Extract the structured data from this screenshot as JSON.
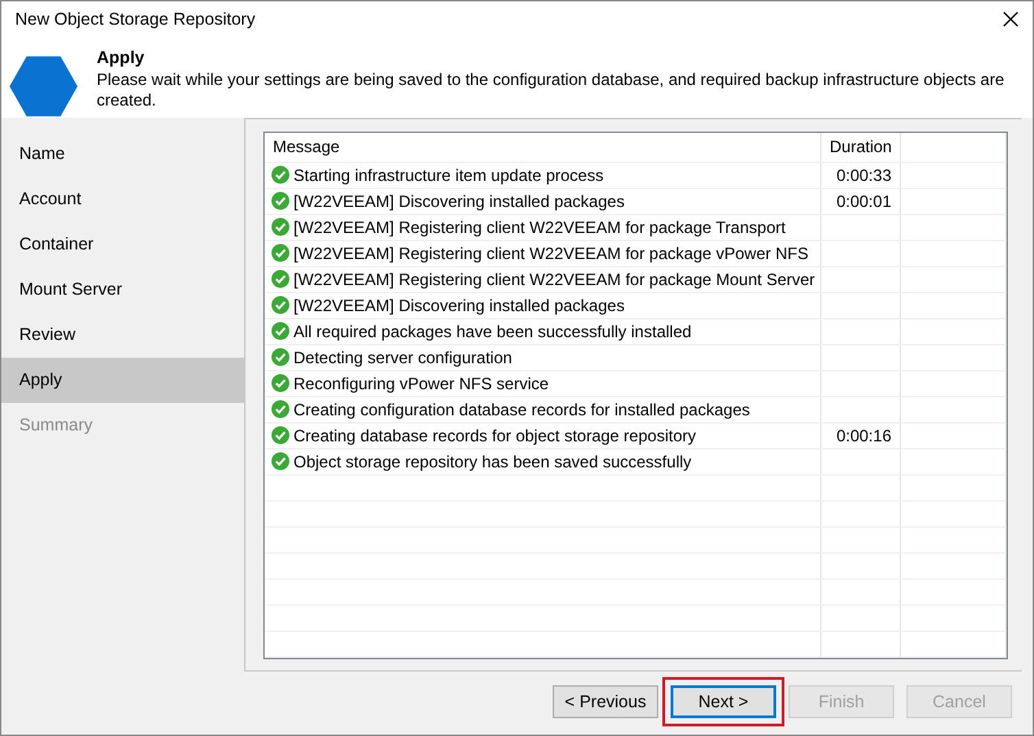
{
  "window": {
    "title": "New Object Storage Repository"
  },
  "header": {
    "title": "Apply",
    "description": "Please wait while your settings are being saved to the configuration database, and required backup infrastructure objects are created."
  },
  "sidebar": {
    "items": [
      {
        "label": "Name",
        "selected": false,
        "disabled": false
      },
      {
        "label": "Account",
        "selected": false,
        "disabled": false
      },
      {
        "label": "Container",
        "selected": false,
        "disabled": false
      },
      {
        "label": "Mount Server",
        "selected": false,
        "disabled": false
      },
      {
        "label": "Review",
        "selected": false,
        "disabled": false
      },
      {
        "label": "Apply",
        "selected": true,
        "disabled": false
      },
      {
        "label": "Summary",
        "selected": false,
        "disabled": true
      }
    ]
  },
  "table": {
    "columns": [
      "Message",
      "Duration"
    ],
    "rows": [
      {
        "kind": "success",
        "message": "Starting infrastructure item update process",
        "duration": "0:00:33"
      },
      {
        "kind": "success",
        "message": "[W22VEEAM] Discovering installed packages",
        "duration": "0:00:01"
      },
      {
        "kind": "success",
        "message": "[W22VEEAM] Registering client W22VEEAM for package Transport"
      },
      {
        "kind": "success",
        "message": "[W22VEEAM] Registering client W22VEEAM for package vPower NFS"
      },
      {
        "kind": "success",
        "message": "[W22VEEAM] Registering client W22VEEAM for package Mount Server"
      },
      {
        "kind": "success",
        "message": "[W22VEEAM] Discovering installed packages"
      },
      {
        "kind": "success",
        "message": "All required packages have been successfully installed"
      },
      {
        "kind": "success",
        "message": "Detecting server configuration"
      },
      {
        "kind": "success",
        "message": "Reconfiguring vPower NFS service"
      },
      {
        "kind": "success",
        "message": "Creating configuration database records for installed packages"
      },
      {
        "kind": "success",
        "message": "Creating database records for object storage repository",
        "duration": "0:00:16"
      },
      {
        "kind": "success",
        "message": "Object storage repository has been saved successfully"
      }
    ]
  },
  "buttons": [
    {
      "label": "< Previous",
      "disabled": false,
      "focused": false,
      "highlighted": false
    },
    {
      "label": "Next >",
      "disabled": false,
      "focused": true,
      "highlighted": true
    },
    {
      "label": "Finish",
      "disabled": true,
      "focused": false,
      "highlighted": false
    },
    {
      "label": "Cancel",
      "disabled": true,
      "focused": false,
      "highlighted": false
    }
  ]
}
